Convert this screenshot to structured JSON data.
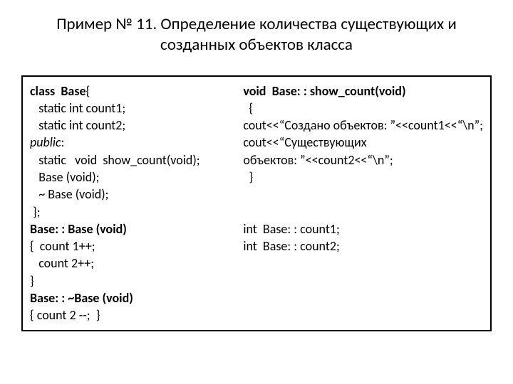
{
  "title": "Пример № 11. Определение количества существующих и созданных объектов класса",
  "left": {
    "l1a": "class  Base",
    "l1b": "{",
    "l2": "   static int count1;",
    "l3": "   static int count2;",
    "l4": "public",
    "l4b": ":",
    "l5": "   static   void  show_count(void);",
    "l6": "   Base (void);",
    "l7": "   ~ Base (void);",
    "l8": " };",
    "l9": "Base: : Base (void)",
    "l10": "{  count 1++;",
    "l11": "   count 2++;",
    "l12": "}",
    "l13": "Base: : ~Base (void)",
    "l14": "{ count 2 --;  }"
  },
  "right": {
    "r1": "void  Base: : show_count(void)",
    "r2": "  {",
    "r3": "cout<<“Создано объектов: ”<<count1<<“\\n”;",
    "r4": "cout<<“Существующих",
    "r5": "объектов: ”<<count2<<“\\n”;",
    "r6": "  }",
    "blank": "",
    "r7": "int  Base: : count1;",
    "r8": "int  Base: : count2;"
  }
}
